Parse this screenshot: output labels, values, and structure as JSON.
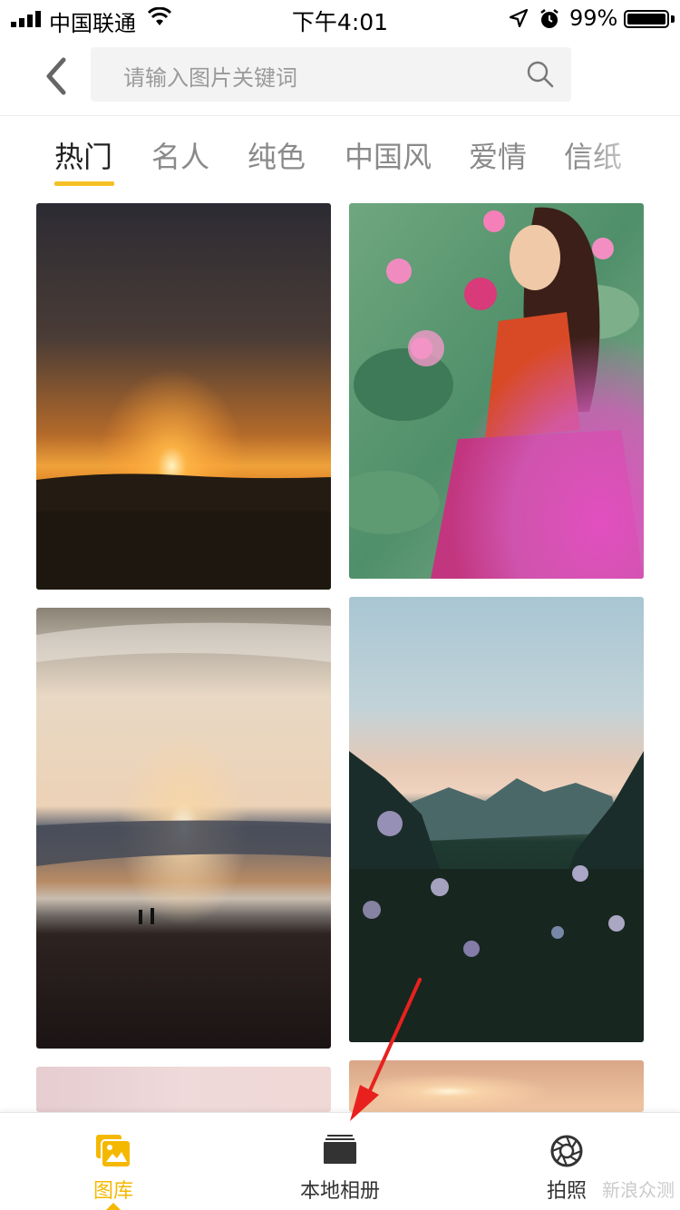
{
  "status_bar": {
    "carrier": "中国联通",
    "time": "下午4:01",
    "battery": "99%",
    "battery_level": 0.99,
    "icons": [
      "signal-icon",
      "wifi-icon",
      "location-icon",
      "alarm-icon",
      "battery-icon"
    ]
  },
  "header": {
    "back_icon": "chevron-left-icon",
    "search_placeholder": "请输入图片关键词",
    "search_icon": "search-icon"
  },
  "tabs": [
    {
      "label": "热门",
      "active": true
    },
    {
      "label": "名人",
      "active": false
    },
    {
      "label": "纯色",
      "active": false
    },
    {
      "label": "中国风",
      "active": false
    },
    {
      "label": "爱情",
      "active": false
    },
    {
      "label": "信纸",
      "active": false
    }
  ],
  "images": [
    {
      "name": "sunset-field-photo"
    },
    {
      "name": "lotus-girl-photo"
    },
    {
      "name": "beach-sunset-photo"
    },
    {
      "name": "mountain-flowers-photo"
    },
    {
      "name": "pink-sky-photo"
    },
    {
      "name": "orange-sun-photo"
    }
  ],
  "bottom_nav": {
    "items": [
      {
        "label": "图库",
        "icon": "gallery-icon",
        "active": true
      },
      {
        "label": "本地相册",
        "icon": "album-icon",
        "active": false
      },
      {
        "label": "拍照",
        "icon": "camera-shutter-icon",
        "active": false
      }
    ]
  },
  "watermark": "新浪众测",
  "colors": {
    "accent": "#f5c026",
    "active_nav": "#f5b800",
    "annotation_arrow": "#e8211f"
  }
}
